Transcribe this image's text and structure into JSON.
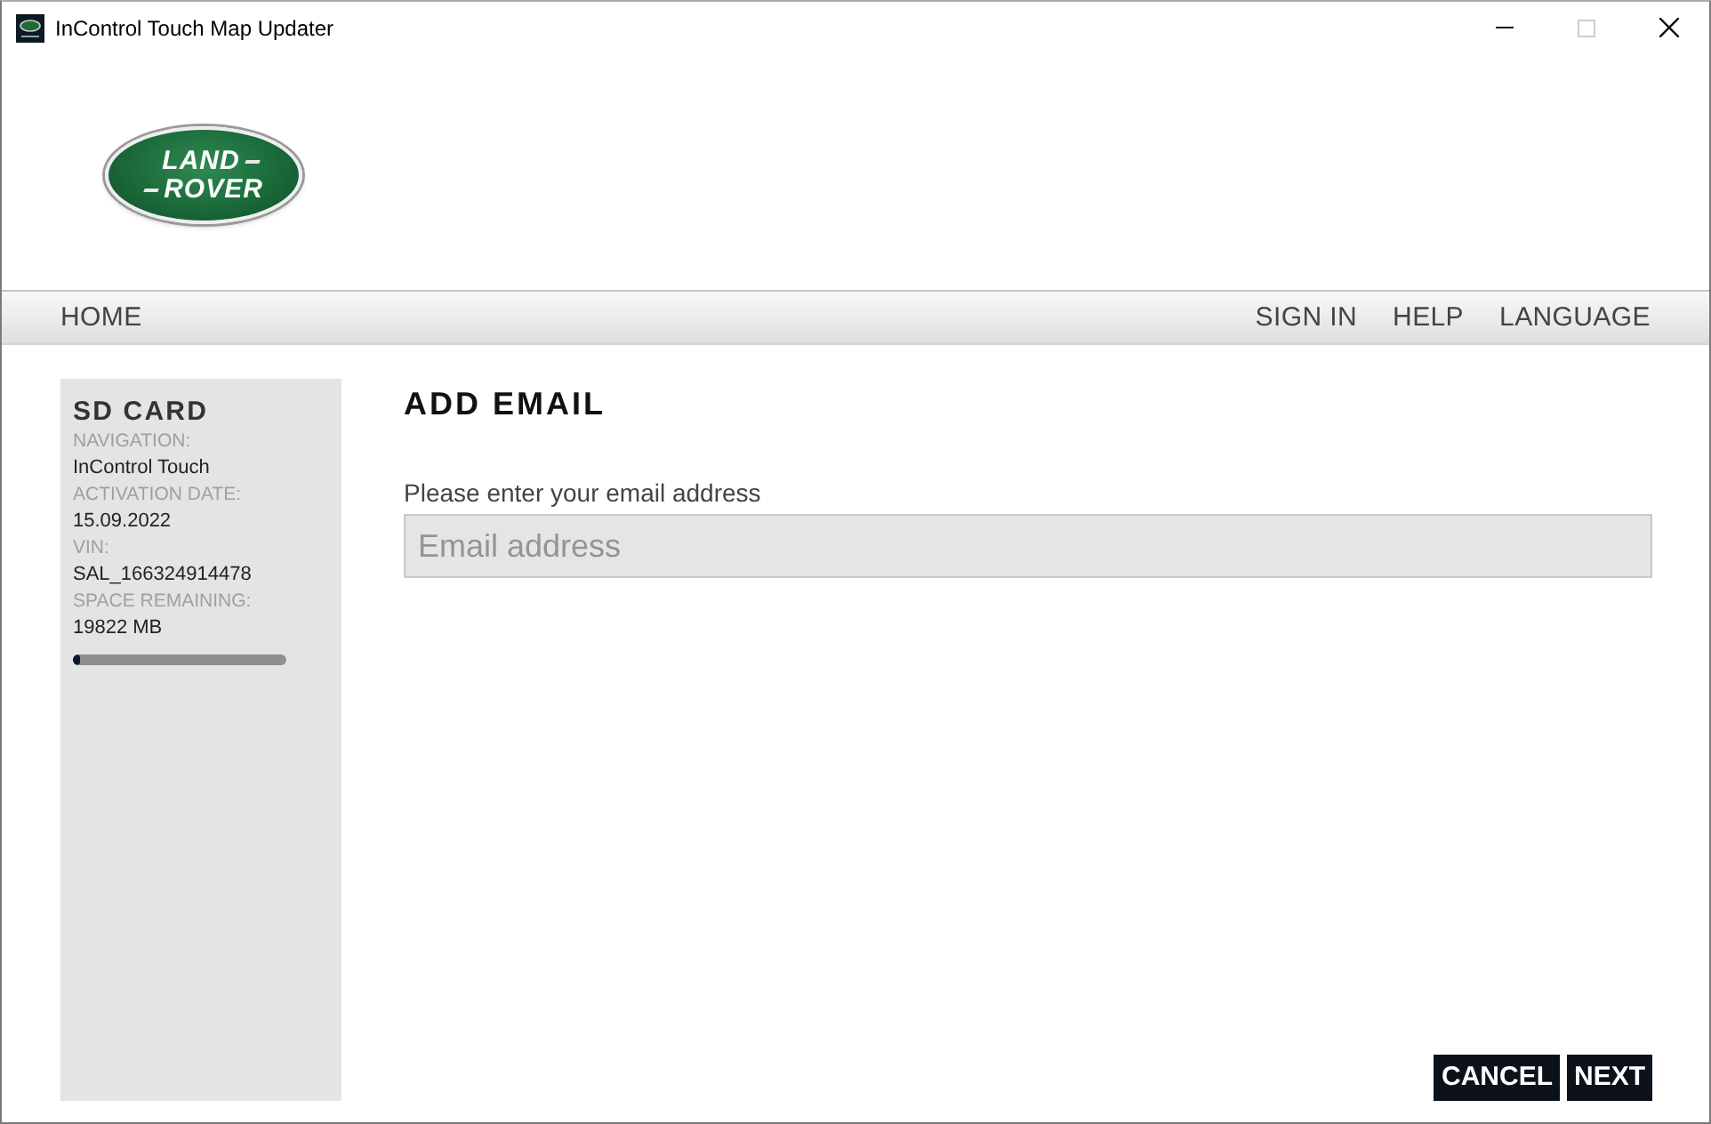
{
  "window": {
    "title": "InControl Touch Map Updater",
    "controls": [
      {
        "kind": "minimize",
        "disabled": false
      },
      {
        "kind": "maximize",
        "disabled": true
      },
      {
        "kind": "close",
        "disabled": false
      }
    ]
  },
  "logo": {
    "lines": [
      "LAND",
      "ROVER"
    ]
  },
  "nav": {
    "left": [
      {
        "label": "HOME"
      }
    ],
    "right": [
      {
        "label": "SIGN IN"
      },
      {
        "label": "HELP"
      },
      {
        "label": "LANGUAGE"
      }
    ]
  },
  "sidebar": {
    "title": "SD CARD",
    "fields": [
      {
        "label": "NAVIGATION:",
        "value": "InControl Touch"
      },
      {
        "label": "ACTIVATION DATE:",
        "value": "15.09.2022"
      },
      {
        "label": "VIN:",
        "value": "SAL_166324914478"
      },
      {
        "label": "SPACE REMAINING:",
        "value": "19822 MB"
      }
    ],
    "storage": {
      "level": 0.03
    }
  },
  "main": {
    "heading": "ADD EMAIL",
    "email_field": {
      "label": "Please enter your email address",
      "placeholder": "Email address"
    }
  },
  "buttons": [
    {
      "label": "CANCEL"
    },
    {
      "label": "NEXT"
    }
  ]
}
